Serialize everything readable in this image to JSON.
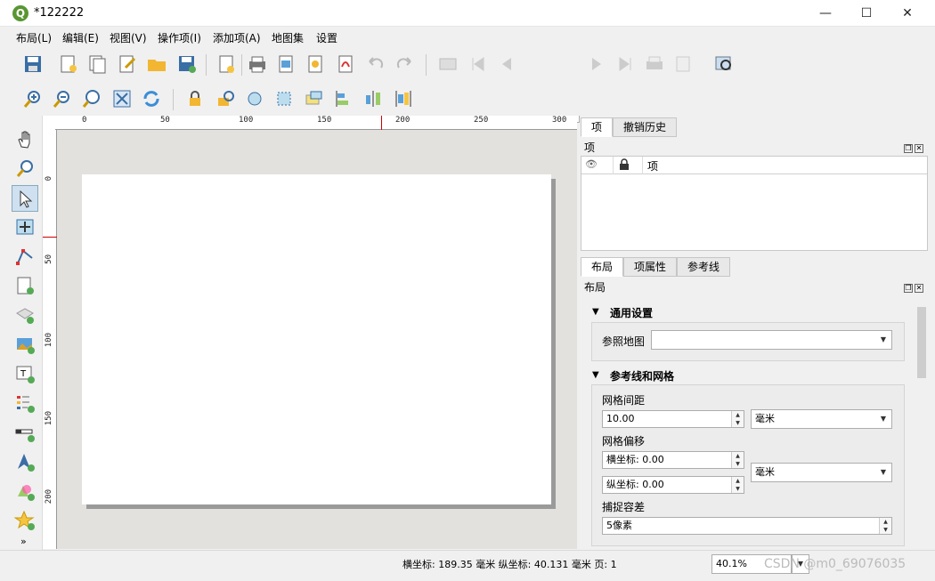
{
  "window": {
    "title": "*122222",
    "minimize": "—",
    "maximize": "☐",
    "close": "✕"
  },
  "menu": [
    "布局(L)",
    "编辑(E)",
    "视图(V)",
    "操作项(I)",
    "添加项(A)",
    "地图集",
    "设置"
  ],
  "toolbar": {
    "page_field": "1"
  },
  "ruler": {
    "h_labels": [
      "0",
      "50",
      "100",
      "150",
      "200",
      "250",
      "300"
    ],
    "v_labels": [
      "0",
      "50",
      "100",
      "150",
      "200"
    ]
  },
  "panels": {
    "top_tabs": [
      "项",
      "撤销历史"
    ],
    "items_title": "项",
    "items_column": "项",
    "bottom_tabs": [
      "布局",
      "项属性",
      "参考线"
    ],
    "layout_title": "布局",
    "general_section": "通用设置",
    "reference_map_label": "参照地图",
    "guides_section": "参考线和网格",
    "grid_spacing_label": "网格间距",
    "grid_spacing_value": "10.00",
    "grid_spacing_unit": "毫米",
    "grid_offset_label": "网格偏移",
    "offset_x": "横坐标: 0.00",
    "offset_y": "纵坐标: 0.00",
    "offset_unit": "毫米",
    "snap_label": "捕捉容差",
    "snap_value": "5像素"
  },
  "status": {
    "coords": "横坐标: 189.35 毫米 纵坐标: 40.131 毫米 页: 1",
    "zoom": "40.1%"
  },
  "watermark": "CSDN @m0_69076035"
}
